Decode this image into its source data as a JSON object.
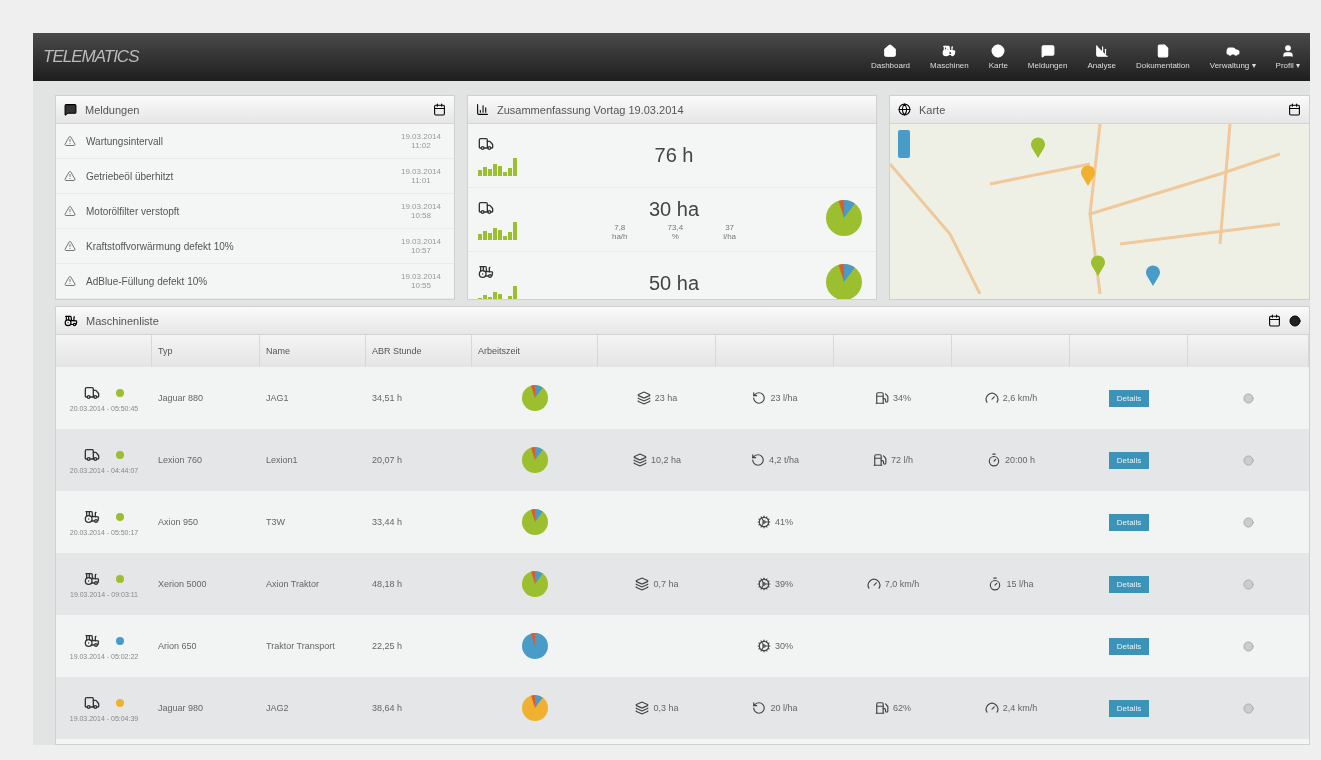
{
  "app": {
    "logo": "TELEMATICS"
  },
  "nav": [
    {
      "label": "Dashboard"
    },
    {
      "label": "Maschinen"
    },
    {
      "label": "Karte"
    },
    {
      "label": "Meldungen"
    },
    {
      "label": "Analyse"
    },
    {
      "label": "Dokumentation"
    },
    {
      "label": "Verwaltung ▾"
    },
    {
      "label": "Profil ▾"
    }
  ],
  "alerts": {
    "title": "Meldungen",
    "items": [
      {
        "text": "Wartungsintervall",
        "time": "19.03.2014 11:02"
      },
      {
        "text": "Getriebeöl überhitzt",
        "time": "19.03.2014 11:01"
      },
      {
        "text": "Motorölfilter verstopft",
        "time": "19.03.2014 10:58"
      },
      {
        "text": "Kraftstoffvorwärmung defekt 10%",
        "time": "19.03.2014 10:57"
      },
      {
        "text": "AdBlue-Füllung defekt 10%",
        "time": "19.03.2014 10:55"
      }
    ]
  },
  "summary": {
    "title": "Zusammenfassung Vortag 19.03.2014",
    "items": [
      {
        "kind": "harvester",
        "value": "76 h",
        "pie": false
      },
      {
        "kind": "harvester",
        "value": "30 ha",
        "stats": [
          {
            "value": "7,8",
            "unit": "ha/h"
          },
          {
            "value": "73,4",
            "unit": "%"
          },
          {
            "value": "37",
            "unit": "l/ha"
          }
        ],
        "pie": true
      },
      {
        "kind": "tractor",
        "value": "50 ha",
        "pie": true
      }
    ]
  },
  "map": {
    "title": "Karte"
  },
  "machines": {
    "title": "Maschinenliste",
    "columns": [
      {
        "label": "Typ"
      },
      {
        "label": "Name"
      },
      {
        "label": "ABR Stunde"
      },
      {
        "label": "Arbeitszeit"
      }
    ],
    "rows": [
      {
        "kind": "harvester",
        "color": "#9bbf2e",
        "timestamp": "20.03.2014 - 05:50:45",
        "type": "Jaguar 880",
        "name": "JAG1",
        "hours": "34,51 h",
        "metrics": [
          {
            "kind": "area",
            "value": "23 ha"
          },
          {
            "kind": "turn",
            "value": "23 l/ha"
          },
          {
            "kind": "fuel",
            "value": "34%"
          },
          {
            "kind": "speed",
            "value": "2,6 km/h"
          }
        ],
        "button": "Details"
      },
      {
        "kind": "harvester",
        "color": "#9bbf2e",
        "timestamp": "20.03.2014 - 04:44:07",
        "type": "Lexion 760",
        "name": "Lexion1",
        "hours": "20,07 h",
        "metrics": [
          {
            "kind": "area",
            "value": "10,2 ha"
          },
          {
            "kind": "turn",
            "value": "4,2 t/ha"
          },
          {
            "kind": "fuel",
            "value": "72 l/h"
          },
          {
            "kind": "time",
            "value": "20:00 h"
          }
        ],
        "button": "Details"
      },
      {
        "kind": "tractor",
        "color": "#9bbf2e",
        "timestamp": "20.03.2014 - 05:50:17",
        "type": "Axion 950",
        "name": "T3W",
        "hours": "33,44 h",
        "metrics": [
          {
            "kind": "none"
          },
          {
            "kind": "engine",
            "value": "41%"
          },
          {
            "kind": "none"
          },
          {
            "kind": "none"
          }
        ],
        "button": "Details"
      },
      {
        "kind": "tractor",
        "color": "#9bbf2e",
        "timestamp": "19.03.2014 - 09:03:11",
        "type": "Xerion 5000",
        "name": "Axion Traktor",
        "hours": "48,18 h",
        "metrics": [
          {
            "kind": "area",
            "value": "0,7 ha"
          },
          {
            "kind": "engine",
            "value": "39%"
          },
          {
            "kind": "speed",
            "value": "7,0 km/h"
          },
          {
            "kind": "time",
            "value": "15 l/ha"
          }
        ],
        "button": "Details"
      },
      {
        "kind": "tractor",
        "color": "#4a9cc8",
        "timestamp": "19.03.2014 - 05:02:22",
        "type": "Arion 650",
        "name": "Traktor Transport",
        "hours": "22,25 h",
        "metrics": [
          {
            "kind": "none"
          },
          {
            "kind": "engine",
            "value": "30%"
          },
          {
            "kind": "none"
          },
          {
            "kind": "none"
          }
        ],
        "button": "Details"
      },
      {
        "kind": "harvester",
        "color": "#f0b030",
        "timestamp": "19.03.2014 - 05:04:39",
        "type": "Jaguar 980",
        "name": "JAG2",
        "hours": "38,64 h",
        "metrics": [
          {
            "kind": "area",
            "value": "0,3 ha"
          },
          {
            "kind": "turn",
            "value": "20 l/ha"
          },
          {
            "kind": "fuel",
            "value": "62%"
          },
          {
            "kind": "speed",
            "value": "2,4 km/h"
          }
        ],
        "button": "Details"
      }
    ]
  }
}
